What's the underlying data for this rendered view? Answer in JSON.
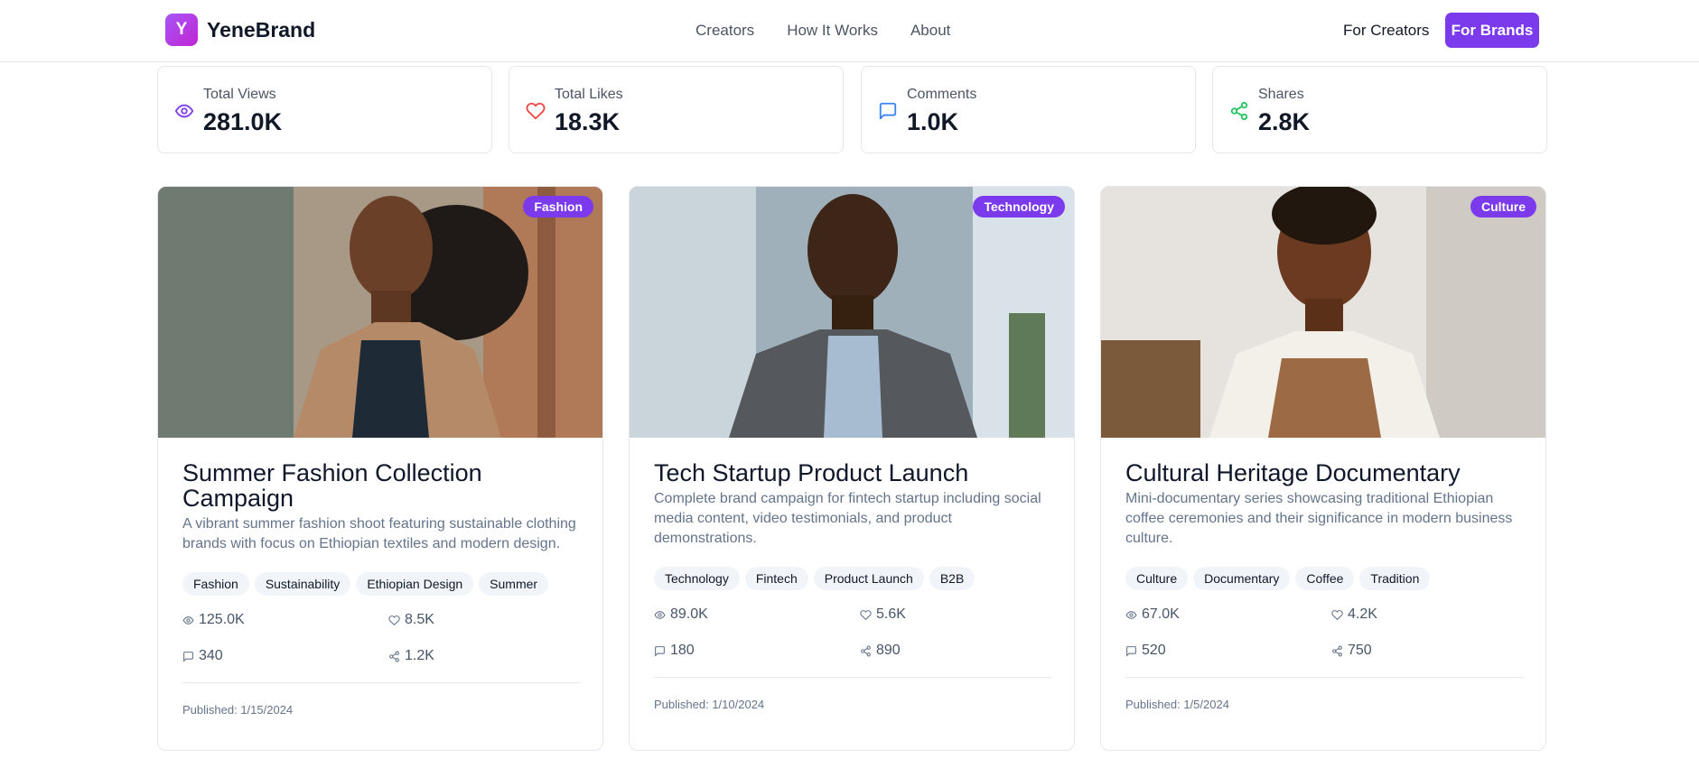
{
  "header": {
    "logo_letter": "Y",
    "brand_name": "YeneBrand",
    "nav": [
      "Creators",
      "How It Works",
      "About"
    ],
    "for_creators": "For Creators",
    "for_brands": "For Brands"
  },
  "stats": [
    {
      "label": "Total Views",
      "value": "281.0K",
      "icon": "eye-icon",
      "color": "#7c3aed"
    },
    {
      "label": "Total Likes",
      "value": "18.3K",
      "icon": "heart-icon",
      "color": "#ef4444"
    },
    {
      "label": "Comments",
      "value": "1.0K",
      "icon": "comment-icon",
      "color": "#3b82f6"
    },
    {
      "label": "Shares",
      "value": "2.8K",
      "icon": "share-icon",
      "color": "#22c55e"
    }
  ],
  "projects": [
    {
      "category": "Fashion",
      "title": "Summer Fashion Collection Campaign",
      "description": "A vibrant summer fashion shoot featuring sustainable clothing brands with focus on Ethiopian textiles and modern design.",
      "tags": [
        "Fashion",
        "Sustainability",
        "Ethiopian Design",
        "Summer"
      ],
      "views": "125.0K",
      "likes": "8.5K",
      "comments": "340",
      "shares": "1.2K",
      "published": "Published: 1/15/2024"
    },
    {
      "category": "Technology",
      "title": "Tech Startup Product Launch",
      "description": "Complete brand campaign for fintech startup including social media content, video testimonials, and product demonstrations.",
      "tags": [
        "Technology",
        "Fintech",
        "Product Launch",
        "B2B"
      ],
      "views": "89.0K",
      "likes": "5.6K",
      "comments": "180",
      "shares": "890",
      "published": "Published: 1/10/2024"
    },
    {
      "category": "Culture",
      "title": "Cultural Heritage Documentary",
      "description": "Mini-documentary series showcasing traditional Ethiopian coffee ceremonies and their significance in modern business culture.",
      "tags": [
        "Culture",
        "Documentary",
        "Coffee",
        "Tradition"
      ],
      "views": "67.0K",
      "likes": "4.2K",
      "comments": "520",
      "shares": "750",
      "published": "Published: 1/5/2024"
    }
  ],
  "colors": {
    "accent": "#7c3aed"
  }
}
